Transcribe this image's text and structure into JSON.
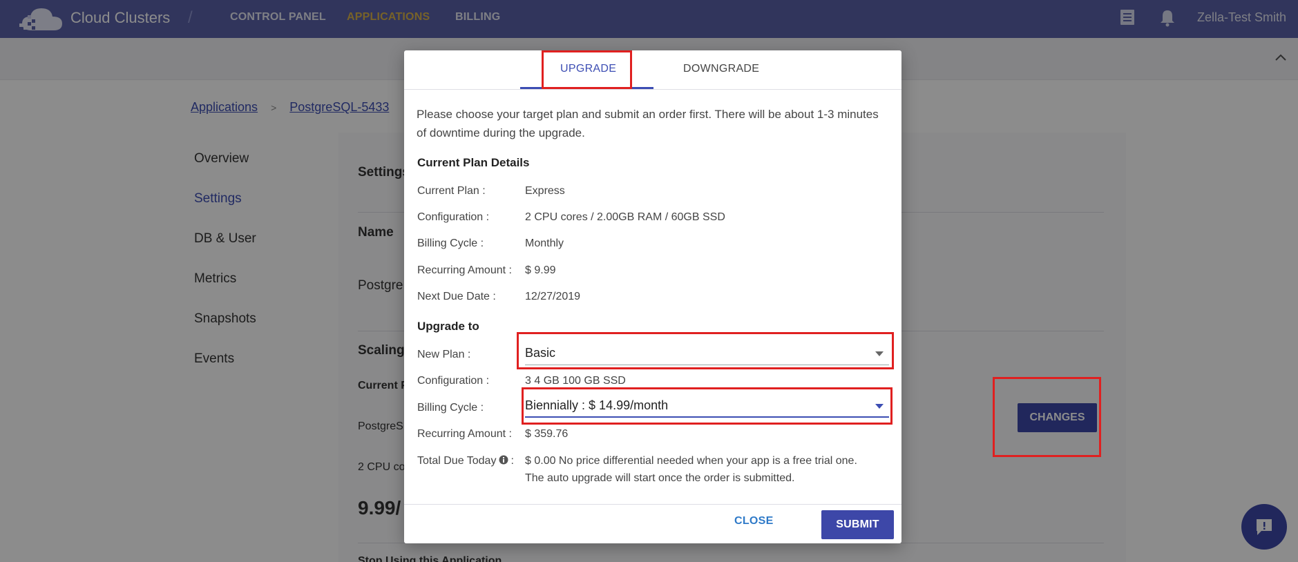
{
  "nav": {
    "brand": "Cloud Clusters",
    "separator": "/",
    "items": [
      {
        "label": "CONTROL PANEL"
      },
      {
        "label": "APPLICATIONS"
      },
      {
        "label": "BILLING"
      }
    ],
    "user": "Zella-Test Smith",
    "active_color": "#d9b24a"
  },
  "breadcrumb": {
    "items": [
      "Applications",
      "PostgreSQL-5433"
    ],
    "separator": ">"
  },
  "sidebar": {
    "items": [
      {
        "label": "Overview"
      },
      {
        "label": "Settings"
      },
      {
        "label": "DB & User"
      },
      {
        "label": "Metrics"
      },
      {
        "label": "Snapshots"
      },
      {
        "label": "Events"
      }
    ]
  },
  "background": {
    "settings": "Settings",
    "name": "Name",
    "postgre": "Postgre",
    "scaling": "Scaling",
    "current_p": "Current P",
    "postgres": "PostgreS",
    "cpu": "2 CPU co",
    "price": "9.99/",
    "stop": "Stop Using this Application",
    "changes_label": "CHANGES"
  },
  "modal": {
    "tabs": [
      {
        "label": "UPGRADE"
      },
      {
        "label": "DOWNGRADE"
      }
    ],
    "intro": "Please choose your target plan and submit an order first. There will be about 1-3 minutes of downtime during the upgrade.",
    "current": {
      "title": "Current Plan Details",
      "rows": [
        {
          "label": "Current Plan :",
          "value": "Express"
        },
        {
          "label": "Configuration :",
          "value": "2 CPU cores / 2.00GB RAM / 60GB SSD"
        },
        {
          "label": "Billing Cycle :",
          "value": "Monthly"
        },
        {
          "label": "Recurring Amount :",
          "value": "$ 9.99"
        },
        {
          "label": "Next Due Date :",
          "value": "12/27/2019"
        }
      ]
    },
    "upgrade": {
      "title": "Upgrade to",
      "new_plan_label": "New Plan :",
      "new_plan_value": "Basic",
      "configuration_label": "Configuration :",
      "configuration_value": "3 4 GB 100 GB SSD",
      "billing_cycle_label": "Billing Cycle :",
      "billing_cycle_value": "Biennially : $ 14.99/month",
      "recurring_label": "Recurring Amount :",
      "recurring_value": "$ 359.76",
      "total_label": "Total Due Today",
      "total_colon": ":",
      "total_line1": "$ 0.00 No price differential needed when your app is a free trial one.",
      "total_line2": "The auto upgrade will start once the order is submitted."
    },
    "close_label": "CLOSE",
    "submit_label": "SUBMIT"
  },
  "colors": {
    "primary": "#3d47a8",
    "annotation": "#e02020"
  }
}
